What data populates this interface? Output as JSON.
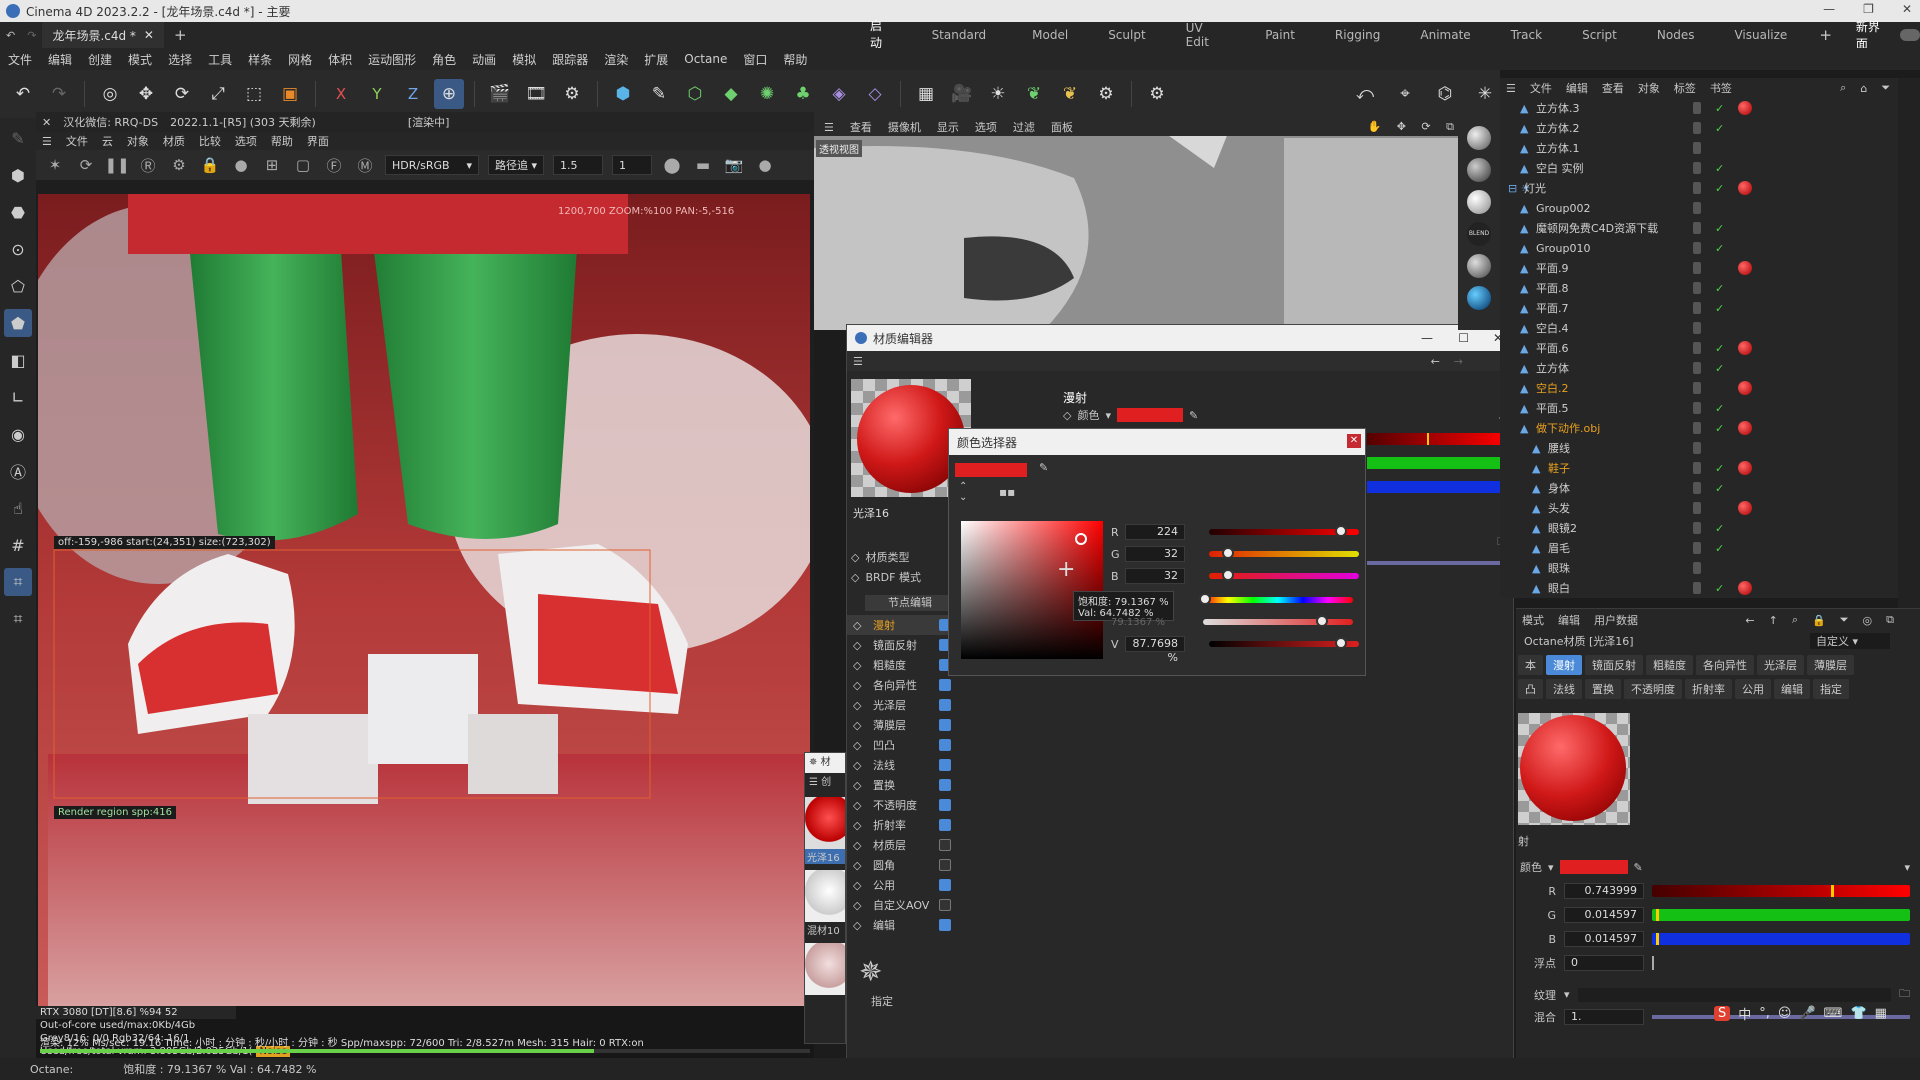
{
  "app": {
    "title": "Cinema 4D 2023.2.2 - [龙年场景.c4d *] - 主要",
    "doc_tab": "龙年场景.c4d *",
    "layouts": [
      "启动",
      "Standard",
      "Model",
      "Sculpt",
      "UV Edit",
      "Paint",
      "Rigging",
      "Animate",
      "Track",
      "Script",
      "Nodes",
      "Visualize"
    ],
    "active_layout": "启动",
    "new_layout": "新界面"
  },
  "menu": [
    "文件",
    "编辑",
    "创建",
    "模式",
    "选择",
    "工具",
    "样条",
    "网格",
    "体积",
    "运动图形",
    "角色",
    "动画",
    "模拟",
    "跟踪器",
    "渲染",
    "扩展",
    "Octane",
    "窗口",
    "帮助"
  ],
  "toolbar": {
    "axis_x": "X",
    "axis_y": "Y",
    "axis_z": "Z"
  },
  "render_viewer": {
    "header_title": "汉化微信: RRQ-DS",
    "header_ver": "2022.1.1-[R5] (303 天剩余)",
    "header_status": "[渲染中]",
    "menu": [
      "文件",
      "云",
      "对象",
      "材质",
      "比较",
      "选项",
      "帮助",
      "界面"
    ],
    "colorspace": "HDR/sRGB",
    "mode": "路径追",
    "value1": "1.5",
    "value2": "1",
    "overlay_info": "1200,700 ZOOM:%100  PAN:-5,-516",
    "region_info": "off:-159,-986 start:(24,351) size:(723,302)",
    "region_spp": "Render region spp:416",
    "status_lines": [
      "RTX 3080 [DT][8.6]        %94     52",
      "Out-of-core used/max:0Kb/4Gb",
      "Grey8/16: 0/0           Rgb32/64: 16/1",
      "Used/free/total vram: 3.805Gb/2.025Gb/1("
    ],
    "status_tail": "Noise",
    "bottom_line": "渲染: 12%    Ms/sec: 19.16    Time: 小时 : 分钟 : 秒/小时 : 分钟 : 秒   Spp/maxspp: 72/600   Tri: 2/8.527m  Mesh: 315  Hair: 0    RTX:on",
    "progress": 0.72
  },
  "viewport": {
    "menu": [
      "查看",
      "摄像机",
      "显示",
      "选项",
      "过滤",
      "面板"
    ],
    "label": "透视视图"
  },
  "material_editor": {
    "title": "材质编辑器",
    "material_name": "光泽16",
    "section": "漫射",
    "color_label": "颜色",
    "mat_type_label": "材质类型",
    "brdf_label": "BRDF 模式",
    "node_edit": "节点编辑",
    "channels": [
      {
        "label": "漫射",
        "on": true,
        "active": true
      },
      {
        "label": "镜面反射",
        "on": true
      },
      {
        "label": "粗糙度",
        "on": true
      },
      {
        "label": "各向异性",
        "on": true
      },
      {
        "label": "光泽层",
        "on": true
      },
      {
        "label": "薄膜层",
        "on": true
      },
      {
        "label": "凹凸",
        "on": true
      },
      {
        "label": "法线",
        "on": true
      },
      {
        "label": "置换",
        "on": true
      },
      {
        "label": "不透明度",
        "on": true
      },
      {
        "label": "折射率",
        "on": true
      },
      {
        "label": "材质层",
        "on": false
      },
      {
        "label": "圆角",
        "on": false
      },
      {
        "label": "公用",
        "on": true
      },
      {
        "label": "自定义AOV",
        "on": false
      },
      {
        "label": "编辑",
        "on": true
      }
    ],
    "help_label": "指定",
    "mini_tabs": [
      "材",
      "创"
    ],
    "mini_mats": [
      "光泽16",
      "混材10"
    ]
  },
  "color_picker": {
    "title": "颜色选择器",
    "r": "224",
    "g": "32",
    "b": "32",
    "s": "79.1367 %",
    "v": "87.7698 %",
    "tooltip_sat": "饱和度: 79.1367 %",
    "tooltip_val": "Val: 64.7482 %",
    "labels": {
      "r": "R",
      "g": "G",
      "b": "B",
      "v": "V"
    },
    "r_frac": 0.878,
    "g_frac": 0.125,
    "b_frac": 0.125,
    "sat_frac": 0.79,
    "val_frac": 0.878,
    "swatch": "#e02020"
  },
  "object_manager": {
    "menu": [
      "文件",
      "编辑",
      "查看",
      "对象",
      "标签",
      "书签"
    ],
    "objects": [
      {
        "name": "立方体.3",
        "depth": 1
      },
      {
        "name": "立方体.2",
        "depth": 1
      },
      {
        "name": "立方体.1",
        "depth": 1
      },
      {
        "name": "空白 实例",
        "depth": 1
      },
      {
        "name": "灯光",
        "depth": 0
      },
      {
        "name": "Group002",
        "depth": 1
      },
      {
        "name": "魔顿网免费C4D资源下载",
        "depth": 1
      },
      {
        "name": "Group010",
        "depth": 1
      },
      {
        "name": "平面.9",
        "depth": 1
      },
      {
        "name": "平面.8",
        "depth": 1
      },
      {
        "name": "平面.7",
        "depth": 1
      },
      {
        "name": "空白.4",
        "depth": 1
      },
      {
        "name": "平面.6",
        "depth": 1
      },
      {
        "name": "立方体",
        "depth": 1
      },
      {
        "name": "空白.2",
        "depth": 1,
        "highlight": true
      },
      {
        "name": "平面.5",
        "depth": 1
      },
      {
        "name": "做下动作.obj",
        "depth": 1,
        "highlight": true
      },
      {
        "name": "腰线",
        "depth": 2
      },
      {
        "name": "鞋子",
        "depth": 2,
        "highlight": true
      },
      {
        "name": "身体",
        "depth": 2
      },
      {
        "name": "头发",
        "depth": 2
      },
      {
        "name": "眼镜2",
        "depth": 2
      },
      {
        "name": "眉毛",
        "depth": 2
      },
      {
        "name": "眼珠",
        "depth": 2
      },
      {
        "name": "眼白",
        "depth": 2
      }
    ]
  },
  "attributes": {
    "menu": [
      "模式",
      "编辑",
      "用户数据"
    ],
    "title": "Octane材质 [光泽16]",
    "preset": "自定义",
    "tabs_row1": [
      "本",
      "漫射",
      "镜面反射",
      "粗糙度",
      "各向异性",
      "光泽层",
      "薄膜层"
    ],
    "tabs_row2": [
      "凸",
      "法线",
      "置换",
      "不透明度",
      "折射率",
      "公用",
      "编辑",
      "指定"
    ],
    "section": "射",
    "color_label": "颜色",
    "r_label": "R",
    "r": "0.743999",
    "g_label": "G",
    "g": "0.014597",
    "b_label": "B",
    "b": "0.014597",
    "float_label": "浮点",
    "float": "0",
    "texture_label": "纹理",
    "mix_label": "混合",
    "mix": "1.",
    "r_frac": 0.744,
    "g_frac": 0.015,
    "b_frac": 0.015
  },
  "statusbar": {
    "octane": "Octane:",
    "info": "饱和度 : 79.1367 %  Val : 64.7482 %"
  },
  "colors": {
    "accent": "#3d8fe0",
    "diffuse_red": "#e02020"
  }
}
